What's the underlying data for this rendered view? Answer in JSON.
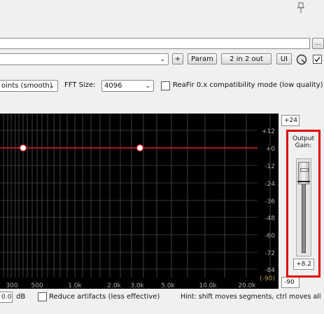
{
  "top_bar": {
    "browse_button_label": "..."
  },
  "preset_row": {
    "preset_value": "",
    "add_button_label": "+",
    "param_button_label": "Param",
    "io_button_label": "2 in 2 out",
    "ui_button_label": "UI"
  },
  "options_row": {
    "mode_value": "oints (smooth)",
    "fft_size_label": "FFT Size:",
    "fft_size_value": "4096",
    "compat_label": "ReaFir 0.x compatibility mode (low quality)"
  },
  "graph": {
    "background": "#000000",
    "grid_color": "#6a6a6a",
    "curve_color": "#e02020",
    "y_tick_labels": [
      "+12",
      "+0",
      "-12",
      "-24",
      "-36",
      "-48",
      "-60",
      "-72",
      "-84"
    ],
    "y_bottom_label": "(-90)",
    "x_tick_labels": [
      "300",
      "500",
      "1.0k",
      "2.0k",
      "3.0k",
      "5.0k",
      "10.0k",
      "20.0k"
    ]
  },
  "range": {
    "top_value": "+24",
    "bottom_value": "-90"
  },
  "output_gain": {
    "label_line1": "Output",
    "label_line2": "Gain:",
    "value": "+8.2",
    "highlight_color": "#e00000"
  },
  "bottom_bar": {
    "gain_value": "0.0",
    "gain_unit": "dB",
    "reduce_label": "Reduce artifacts (less effective)",
    "hint": "Hint: shift moves segments, ctrl moves all"
  }
}
